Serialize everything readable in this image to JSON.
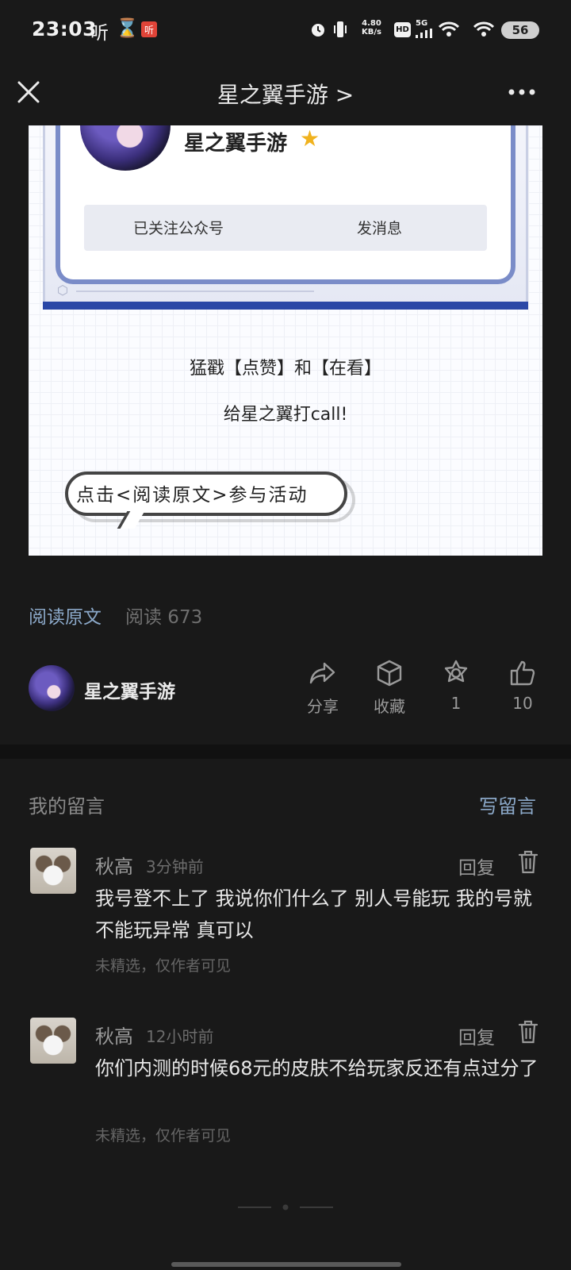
{
  "status_bar": {
    "time": "23:03",
    "icon_1": "听",
    "icon_2": "⌛",
    "icon_3": "听",
    "speed_value": "4.80",
    "speed_unit": "KB/s",
    "hd": "HD",
    "network": "5G",
    "battery": "56"
  },
  "nav": {
    "title": "星之翼手游 >"
  },
  "article_image": {
    "account_name": "星之翼手游",
    "followed_label": "已关注公众号",
    "message_label": "发消息",
    "line1": "猛戳【点赞】和【在看】",
    "line2": "给星之翼打call!",
    "bubble_text": "点击<阅读原文>参与活动"
  },
  "read_info": {
    "read_original": "阅读原文",
    "read_count": "阅读 673"
  },
  "author": {
    "name": "星之翼手游"
  },
  "actions": {
    "share": "分享",
    "collect": "收藏",
    "recommend": "1",
    "like": "10"
  },
  "comments_header": {
    "title": "我的留言",
    "write": "写留言"
  },
  "comments": [
    {
      "name": "秋高",
      "time": "3分钟前",
      "reply": "回复",
      "text": "我号登不上了 我说你们什么了 别人号能玩 我的号就不能玩异常 真可以",
      "meta": "未精选，仅作者可见"
    },
    {
      "name": "秋高",
      "time": "12小时前",
      "reply": "回复",
      "text": "你们内测的时候68元的皮肤不给玩家反还有点过分了",
      "meta": "未精选，仅作者可见"
    }
  ],
  "colors": {
    "background": "#191919",
    "link_blue": "#8ba8c8",
    "muted": "#9a9a9a"
  }
}
